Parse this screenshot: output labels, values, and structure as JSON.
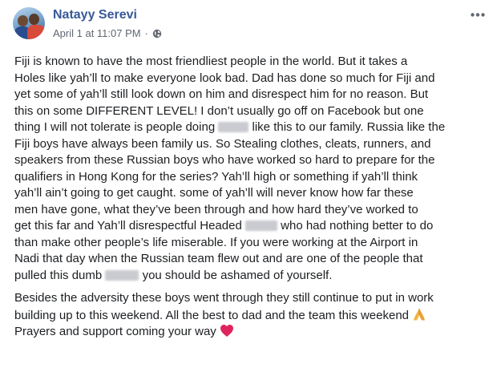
{
  "post": {
    "author": "Natayy Serevi",
    "timestamp": "April 1 at 11:07 PM",
    "separator": "·",
    "privacy_icon": "globe-icon",
    "options_icon": "more-options-icon",
    "paragraphs": [
      [
        "Fiji is known to have the most friendliest people in the world. But it takes a",
        "Holes like yah’ll to make everyone look bad. Dad has done so much for Fiji and",
        "yet some of yah’ll still look down on him and disrespect him for no reason. But",
        "this on some DIFFERENT LEVEL! I don’t usually go off on Facebook but one",
        "thing I will not tolerate is people doing",
        "like this to our family. Russia like the",
        "Fiji boys have always been family us. So Stealing clothes, cleats, runners, and",
        "speakers from these Russian boys who have worked so hard to prepare for the",
        "qualifiers in Hong Kong for the series? Yah’ll high or something if yah’ll think",
        "yah’ll ain’t going to get caught. some of yah’ll will never know how far these",
        "men have gone, what they’ve been through and how hard they’ve worked to",
        "get this far and Yah’ll disrespectful Headed",
        "who had nothing better to do",
        "than make other people’s life miserable. If you were working at the Airport in",
        "Nadi that day when the Russian team flew out and are one of the people that",
        "pulled this dumb",
        "you should be ashamed of yourself."
      ],
      [
        "Besides the adversity these boys went through they still continue to put in work",
        "building up to this weekend. All the best to dad and the team this weekend",
        "Prayers and support coming your way"
      ]
    ],
    "emojis": [
      "praying-hands-icon",
      "red-heart-icon"
    ],
    "colors": {
      "author": "#385898",
      "meta": "#606770",
      "text": "#1c1e21",
      "heart": "#e0245e",
      "hands": "#f5b342"
    }
  }
}
